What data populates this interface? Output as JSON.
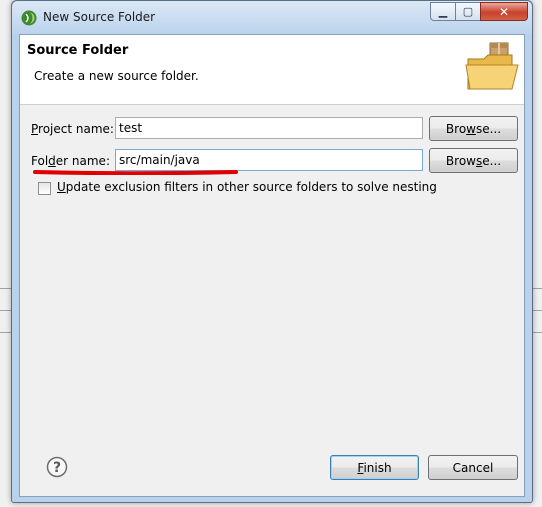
{
  "window": {
    "title": "New Source Folder",
    "controls": {
      "minimize": "▁",
      "maximize": "▢",
      "close": "✕"
    }
  },
  "header": {
    "title": "Source Folder",
    "description": "Create a new source folder."
  },
  "form": {
    "project": {
      "label_prefix": "",
      "label_mnemonic": "P",
      "label_suffix": "roject name:",
      "value": "test",
      "browse_prefix": "Bro",
      "browse_mnemonic": "w",
      "browse_suffix": "se..."
    },
    "folder": {
      "label_prefix": "Fol",
      "label_mnemonic": "d",
      "label_suffix": "er name:",
      "value": "src/main/java",
      "browse_prefix": "Brow",
      "browse_mnemonic": "s",
      "browse_suffix": "e..."
    },
    "exclusion": {
      "checked": false,
      "label_mnemonic": "U",
      "label_suffix": "pdate exclusion filters in other source folders to solve nesting"
    }
  },
  "footer": {
    "help_glyph": "?",
    "finish_mnemonic": "F",
    "finish_suffix": "inish",
    "cancel_label": "Cancel"
  },
  "colors": {
    "annotation_underline": "#e00000",
    "window_frame": "#b9d1ea"
  },
  "icons": [
    "eclipse-app-icon",
    "folder-with-package-icon",
    "help-icon"
  ]
}
